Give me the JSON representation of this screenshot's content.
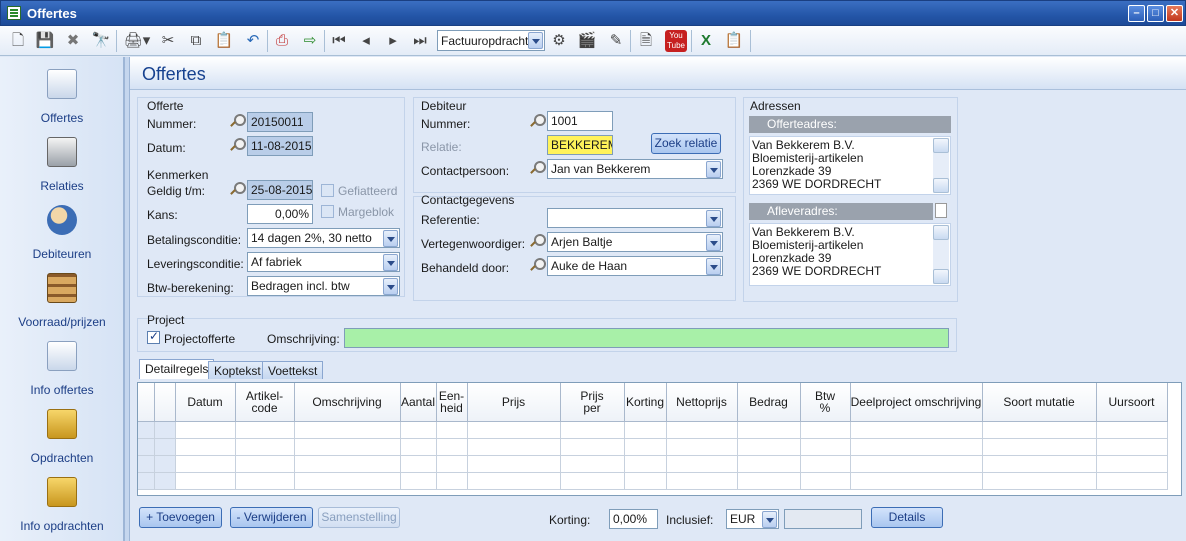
{
  "window": {
    "title": "Offertes"
  },
  "toolbar": {
    "nav_combo": "Factuuropdracht"
  },
  "sidebar": {
    "items": [
      {
        "label": "Offertes",
        "icon": "document-icon"
      },
      {
        "label": "Relaties",
        "icon": "rolodex-icon"
      },
      {
        "label": "Debiteuren",
        "icon": "people-icon"
      },
      {
        "label": "Voorraad/prijzen",
        "icon": "shelf-icon"
      },
      {
        "label": "Info offertes",
        "icon": "info-document-icon"
      },
      {
        "label": "Opdrachten",
        "icon": "box-icon"
      },
      {
        "label": "Info opdrachten",
        "icon": "info-box-icon"
      }
    ]
  },
  "page": {
    "title": "Offertes"
  },
  "offerte": {
    "group_title": "Offerte",
    "nummer_label": "Nummer:",
    "nummer_value": "20150011",
    "datum_label": "Datum:",
    "datum_value": "11-08-2015"
  },
  "kenmerken": {
    "group_title": "Kenmerken",
    "geldig_label": "Geldig t/m:",
    "geldig_value": "25-08-2015",
    "gefiatteerd_label": "Gefiatteerd",
    "kans_label": "Kans:",
    "kans_value": "0,00%",
    "margeblok_label": "Margeblok",
    "betalingsconditie_label": "Betalingsconditie:",
    "betalingsconditie_value": "14 dagen 2%, 30 netto",
    "leveringsconditie_label": "Leveringsconditie:",
    "leveringsconditie_value": "Af fabriek",
    "btw_label": "Btw-berekening:",
    "btw_value": "Bedragen incl. btw"
  },
  "debiteur": {
    "group_title": "Debiteur",
    "nummer_label": "Nummer:",
    "nummer_value": "1001",
    "relatie_label": "Relatie:",
    "relatie_value": "BEKKEREM",
    "zoek_button": "Zoek relatie",
    "contactpersoon_label": "Contactpersoon:",
    "contactpersoon_value": "Jan van Bekkerem"
  },
  "contactgegevens": {
    "group_title": "Contactgegevens",
    "referentie_label": "Referentie:",
    "referentie_value": "",
    "vertegenwoordiger_label": "Vertegenwoordiger:",
    "vertegenwoordiger_value": "Arjen Baltje",
    "behandeld_label": "Behandeld door:",
    "behandeld_value": "Auke de Haan"
  },
  "adressen": {
    "group_title": "Adressen",
    "offerteadres_label": "Offerteadres:",
    "offerteadres_lines": [
      "Van Bekkerem B.V.",
      "Bloemisterij-artikelen",
      "Lorenzkade 39",
      "2369 WE  DORDRECHT"
    ],
    "afleveradres_label": "Afleveradres:",
    "afleveradres_lines": [
      "Van Bekkerem B.V.",
      "Bloemisterij-artikelen",
      "Lorenzkade 39",
      "2369 WE  DORDRECHT"
    ]
  },
  "project": {
    "group_title": "Project",
    "projectofferte_label": "Projectofferte",
    "omschrijving_label": "Omschrijving:",
    "omschrijving_value": ""
  },
  "tabs": [
    "Detailregels",
    "Koptekst",
    "Voettekst"
  ],
  "grid": {
    "columns": [
      "Datum",
      "Artikel-\ncode",
      "Omschrijving",
      "Aantal",
      "Een-\nheid",
      "Prijs",
      "Prijs\nper",
      "Korting",
      "Nettoprijs",
      "Bedrag",
      "Btw\n%",
      "Deelproject omschrijving",
      "Soort mutatie",
      "Uursoort"
    ]
  },
  "bottom": {
    "toevoegen": "+ Toevoegen",
    "verwijderen": "- Verwijderen",
    "samenstelling": "Samenstelling",
    "korting_label": "Korting:",
    "korting_value": "0,00%",
    "inclusief_label": "Inclusief:",
    "currency_value": "EUR",
    "details_button": "Details"
  }
}
